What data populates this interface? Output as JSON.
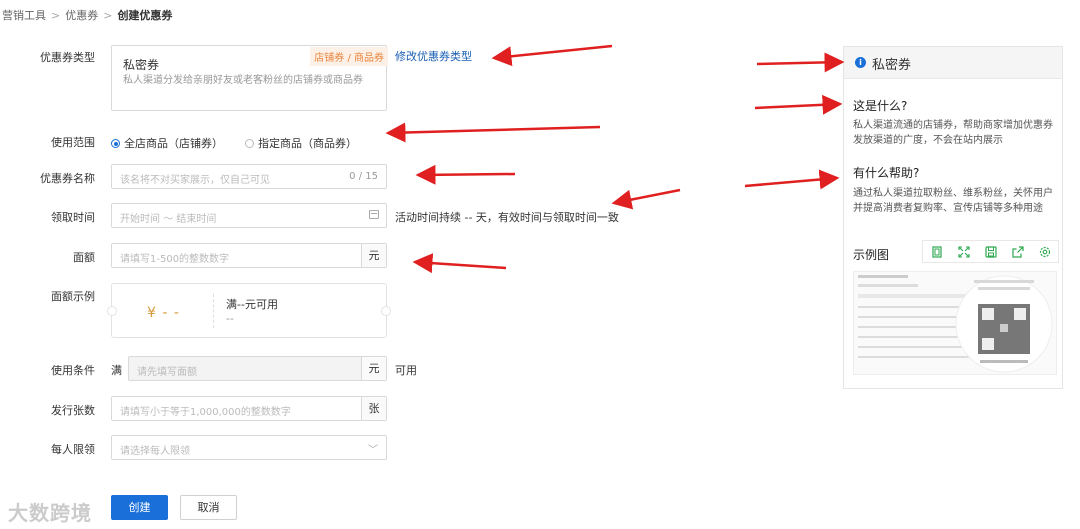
{
  "breadcrumb": {
    "items": [
      "营销工具",
      "优惠券"
    ],
    "current": "创建优惠券",
    "separator": ">"
  },
  "form": {
    "coupon_type": {
      "label": "优惠券类型",
      "name": "私密券",
      "desc": "私人渠道分发给亲朋好友或老客粉丝的店铺券或商品券",
      "tag": "店铺券 / 商品券",
      "modify_link": "修改优惠券类型"
    },
    "scope": {
      "label": "使用范围",
      "options": [
        "全店商品（店铺券）",
        "指定商品（商品券）"
      ],
      "selected": "全店商品（店铺券）"
    },
    "name": {
      "label": "优惠券名称",
      "placeholder": "该名将不对买家展示，仅自己可见",
      "counter": "0 / 15"
    },
    "time": {
      "label": "领取时间",
      "placeholder": "开始时间 ～ 结束时间",
      "hint": "活动时间持续 -- 天，有效时间与领取时间一致"
    },
    "amount": {
      "label": "面额",
      "placeholder": "请填写1-500的整数数字",
      "unit": "元"
    },
    "example": {
      "label": "面额示例",
      "yen": "¥ - -",
      "condition": "满--元可用",
      "condition2": "--"
    },
    "condition": {
      "label": "使用条件",
      "prefix": "满",
      "placeholder": "请先填写面额",
      "unit": "元",
      "suffix": "可用"
    },
    "quantity": {
      "label": "发行张数",
      "placeholder": "请填写小于等于1,000,000的整数数字",
      "unit": "张"
    },
    "limit": {
      "label": "每人限领",
      "placeholder": "请选择每人限领"
    }
  },
  "buttons": {
    "create": "创建",
    "cancel": "取消"
  },
  "panel": {
    "title": "私密券",
    "q1": "这是什么?",
    "a1": "私人渠道流通的店铺券，帮助商家增加优惠券发放渠道的广度，不会在站内展示",
    "q2": "有什么帮助?",
    "a2": "通过私人渠道拉取粉丝、维系粉丝，关怀用户并提高消费者复购率、宣传店铺等多种用途",
    "example_label": "示例图",
    "tools": [
      "copy-icon",
      "expand-icon",
      "save-icon",
      "share-icon",
      "settings-icon"
    ]
  },
  "watermark": "大数跨境",
  "colors": {
    "primary": "#1a6fd8",
    "tag_orange": "#e8833a",
    "arrow_red": "#e02020"
  }
}
